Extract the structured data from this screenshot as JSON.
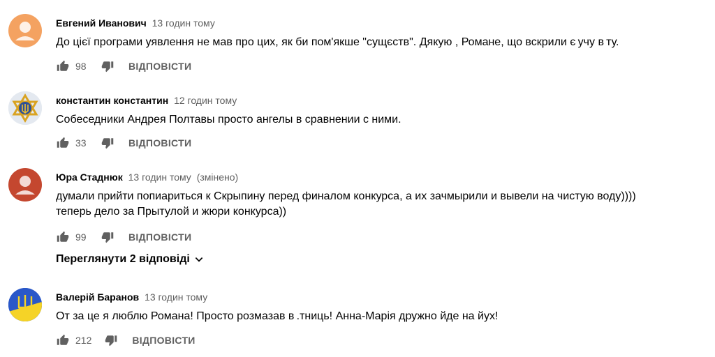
{
  "comments": [
    {
      "author": "Евгений Иванович",
      "time": "13 годин тому",
      "edited": "",
      "text": "До цієї програми уявлення не мав про цих, як би пом'якше \"сущєств\". Дякую , Романе, що вскрили є учу в ту.",
      "likes": "98",
      "reply_label": "ВІДПОВІСТИ",
      "avatar": "default-person-orange"
    },
    {
      "author": "константин константин",
      "time": "12 годин тому",
      "edited": "",
      "text": "Собеседники Андрея Полтавы просто ангелы в сравнении с ними.",
      "likes": "33",
      "reply_label": "ВІДПОВІСТИ",
      "avatar": "star-trident-emblem"
    },
    {
      "author": "Юра Стаднюк",
      "time": "13 годин тому",
      "edited": "(змінено)",
      "text_lines": [
        "думали прийти попиариться к Скрыпину перед финалом конкурса, а их зачмырили и вывели на чистую воду))))",
        "теперь дело за Прытулой и жюри конкурса))"
      ],
      "likes": "99",
      "reply_label": "ВІДПОВІСТИ",
      "avatar": "default-person-red",
      "view_replies": "Переглянути 2 відповіді"
    },
    {
      "author": "Валерій Баранов",
      "time": "13 годин тому",
      "edited": "",
      "text": "От за це я люблю Романа! Просто розмазав в .тниць! Анна-Марія дружно йде на йух!",
      "likes": "212",
      "reply_label": "ВІДПОВІСТИ",
      "avatar": "trident-blue-yellow"
    }
  ],
  "colors": {
    "text": "#030303",
    "secondary": "#606060",
    "avatar_orange": "#f4a460",
    "avatar_red": "#c0452f"
  }
}
